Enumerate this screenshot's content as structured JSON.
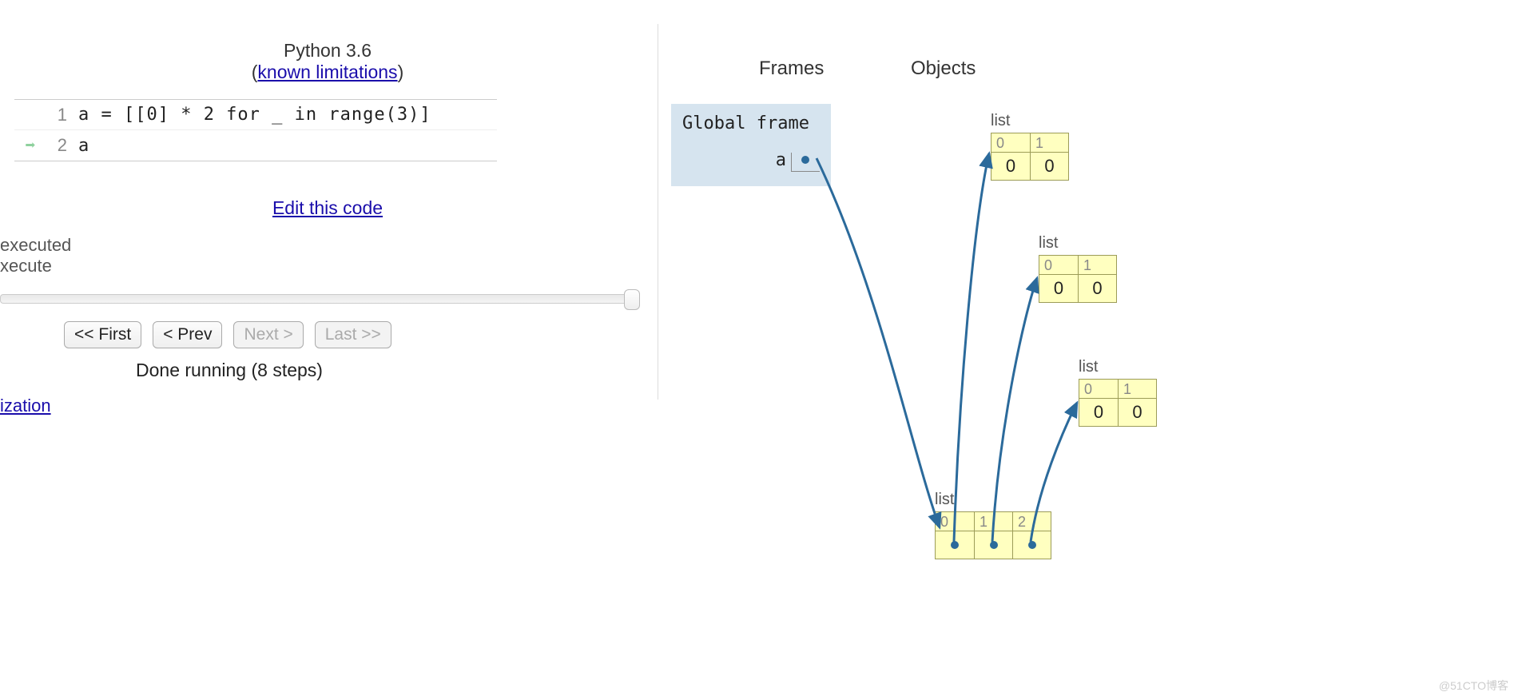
{
  "header": {
    "language": "Python 3.6",
    "limitations_prefix": "(",
    "limitations_link": "known limitations",
    "limitations_suffix": ")"
  },
  "code": {
    "lines": [
      {
        "num": "1",
        "text": "a = [[0] * 2 for _ in range(3)]",
        "arrow": false
      },
      {
        "num": "2",
        "text": "a",
        "arrow": true
      }
    ]
  },
  "edit_link": "Edit this code",
  "status": {
    "line1": "executed",
    "line2": "xecute"
  },
  "buttons": {
    "first": "<< First",
    "prev": "< Prev",
    "next": "Next >",
    "last": "Last >>"
  },
  "done": "Done running (8 steps)",
  "partial_link": "ization",
  "columns": {
    "frames": "Frames",
    "objects": "Objects"
  },
  "global_frame": {
    "title": "Global frame",
    "var": "a"
  },
  "lists": {
    "label": "list",
    "small": [
      {
        "indices": [
          "0",
          "1"
        ],
        "values": [
          "0",
          "0"
        ]
      },
      {
        "indices": [
          "0",
          "1"
        ],
        "values": [
          "0",
          "0"
        ]
      },
      {
        "indices": [
          "0",
          "1"
        ],
        "values": [
          "0",
          "0"
        ]
      }
    ],
    "main": {
      "indices": [
        "0",
        "1",
        "2"
      ]
    }
  },
  "watermark": "@51CTO博客"
}
